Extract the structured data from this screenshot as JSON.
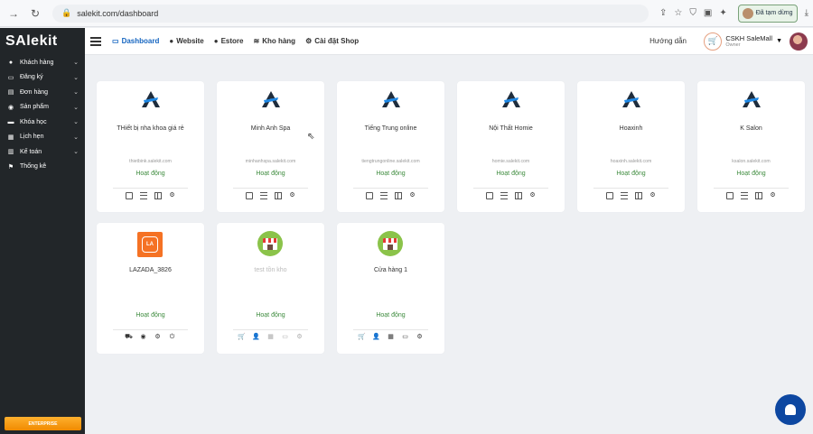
{
  "browser": {
    "url": "salekit.com/dashboard",
    "paused_label": "Đã tạm dừng"
  },
  "app": {
    "logo": "SAlekit"
  },
  "sidebar": {
    "items": [
      {
        "label": "Khách hàng",
        "icon": "user-icon",
        "has_children": true
      },
      {
        "label": "Đăng ký",
        "icon": "register-icon",
        "has_children": true
      },
      {
        "label": "Đơn hàng",
        "icon": "cart-icon",
        "has_children": true
      },
      {
        "label": "Sản phẩm",
        "icon": "product-icon",
        "has_children": true
      },
      {
        "label": "Khóa học",
        "icon": "course-icon",
        "has_children": true
      },
      {
        "label": "Lịch hẹn",
        "icon": "calendar-icon",
        "has_children": true
      },
      {
        "label": "Kế toán",
        "icon": "accounting-icon",
        "has_children": true
      },
      {
        "label": "Thống kê",
        "icon": "flag-icon",
        "has_children": false
      }
    ],
    "enterprise_label": "ENTERPRISE"
  },
  "topnav": {
    "links": [
      {
        "label": "Dashboard",
        "icon": "monitor-icon",
        "active": true
      },
      {
        "label": "Website",
        "icon": "globe-icon",
        "active": false
      },
      {
        "label": "Estore",
        "icon": "globe-icon",
        "active": false
      },
      {
        "label": "Kho hàng",
        "icon": "layers-icon",
        "active": false
      },
      {
        "label": "Cài đặt Shop",
        "icon": "gear-icon",
        "active": false
      }
    ],
    "help": "Hướng dẫn",
    "account_name": "CSKH SaleMall",
    "account_role": "Owner"
  },
  "cards": [
    {
      "title": "THiết bị nha khoa giá rẻ",
      "domain": "thietbink.salekit.com",
      "status": "Hoạt động",
      "logo": "salekit",
      "actions": [
        "keyboard-icon",
        "list-icon",
        "columns-icon",
        "gear-icon"
      ]
    },
    {
      "title": "Minh Anh Spa",
      "domain": "minhanhspa.salekit.com",
      "status": "Hoạt động",
      "logo": "salekit",
      "actions": [
        "keyboard-icon",
        "list-icon",
        "columns-icon",
        "gear-icon"
      ]
    },
    {
      "title": "Tiếng Trung online",
      "domain": "tiengtrungonline.salekit.com",
      "status": "Hoạt động",
      "logo": "salekit",
      "actions": [
        "keyboard-icon",
        "list-icon",
        "columns-icon",
        "gear-icon"
      ]
    },
    {
      "title": "Nội Thất Homie",
      "domain": "homie.salekit.com",
      "status": "Hoạt động",
      "logo": "salekit",
      "actions": [
        "keyboard-icon",
        "list-icon",
        "columns-icon",
        "gear-icon"
      ]
    },
    {
      "title": "Hoaxinh",
      "domain": "hoaxinh.salekit.com",
      "status": "Hoạt động",
      "logo": "salekit",
      "actions": [
        "keyboard-icon",
        "list-icon",
        "columns-icon",
        "gear-icon"
      ]
    },
    {
      "title": "K Salon",
      "domain": "ksalon.salekit.com",
      "status": "Hoạt động",
      "logo": "salekit",
      "actions": [
        "keyboard-icon",
        "list-icon",
        "columns-icon",
        "gear-icon"
      ]
    },
    {
      "title": "LAZADA_3826",
      "domain": "",
      "status": "Hoạt động",
      "logo": "lazada",
      "actions": [
        "shopping-cart-icon",
        "compass-icon",
        "gear-icon",
        "power-icon"
      ]
    },
    {
      "title": "test tồn kho",
      "domain": "",
      "status": "Hoạt động",
      "logo": "store",
      "muted": true,
      "actions": [
        "cart-icon",
        "user-icon",
        "calendar-icon",
        "credit-card-icon",
        "gear-icon"
      ]
    },
    {
      "title": "Cửa hàng 1",
      "domain": "",
      "status": "Hoạt động",
      "logo": "store",
      "actions": [
        "cart-icon",
        "user-icon",
        "calendar-icon",
        "credit-card-icon",
        "gear-icon"
      ]
    }
  ]
}
